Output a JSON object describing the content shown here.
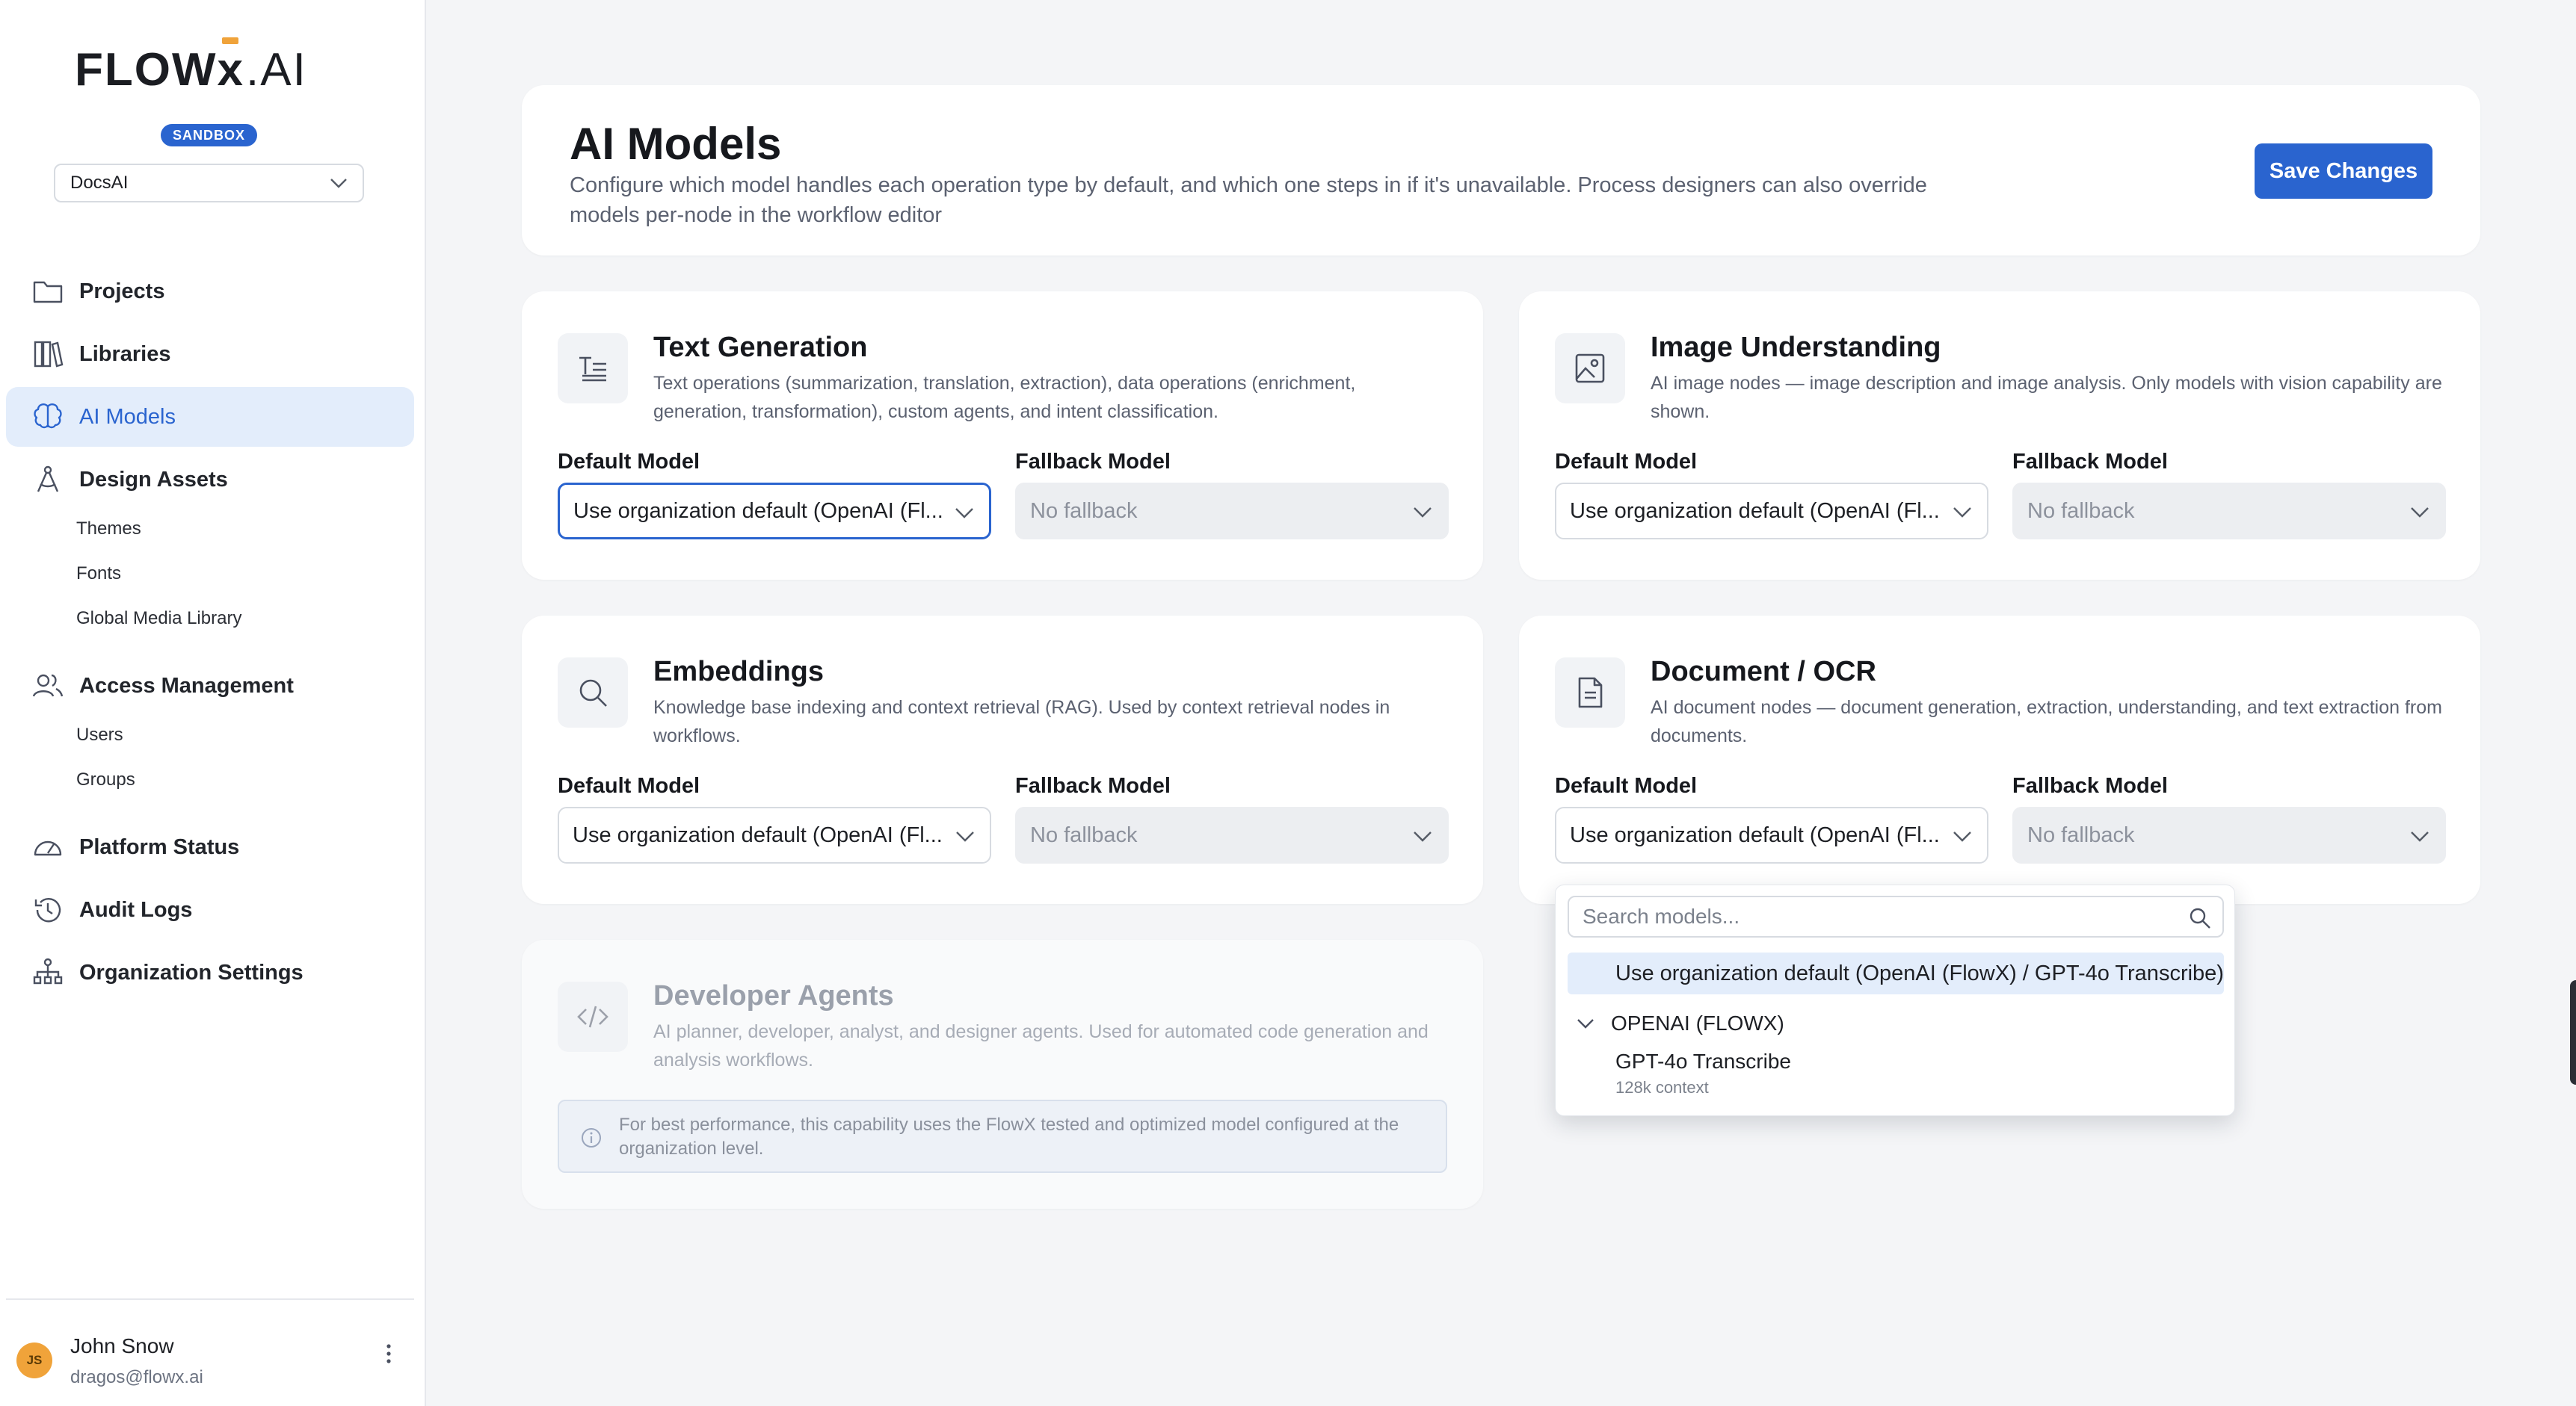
{
  "brand": {
    "logo_flow": "FLOW",
    "logo_x": "x",
    "logo_ai": ".AI",
    "environment_badge": "SANDBOX"
  },
  "workspace": {
    "selected": "DocsAI"
  },
  "sidebar": {
    "items": [
      {
        "label": "Projects",
        "icon": "folder-icon"
      },
      {
        "label": "Libraries",
        "icon": "books-icon"
      },
      {
        "label": "AI Models",
        "icon": "brain-icon",
        "active": true
      },
      {
        "label": "Design Assets",
        "icon": "compass-icon"
      },
      {
        "label": "Access Management",
        "icon": "users-icon"
      },
      {
        "label": "Platform Status",
        "icon": "gauge-icon"
      },
      {
        "label": "Audit Logs",
        "icon": "history-icon"
      },
      {
        "label": "Organization Settings",
        "icon": "org-tree-icon"
      }
    ],
    "design_assets_sub": [
      "Themes",
      "Fonts",
      "Global Media Library"
    ],
    "access_management_sub": [
      "Users",
      "Groups"
    ]
  },
  "user": {
    "initials": "JS",
    "name": "John Snow",
    "email": "dragos@flowx.ai"
  },
  "header": {
    "title": "AI Models",
    "description": "Configure which model handles each operation type by default, and which one steps in if it's unavailable. Process designers can also override models per-node in the workflow editor",
    "save_label": "Save Changes"
  },
  "labels": {
    "default_model": "Default Model",
    "fallback_model": "Fallback Model"
  },
  "capabilities": {
    "text_generation": {
      "title": "Text Generation",
      "description": "Text operations (summarization, translation, extraction), data operations (enrichment, generation, transformation), custom agents, and intent classification.",
      "default_value": "Use organization default (OpenAI (Fl...",
      "fallback_value": "No fallback"
    },
    "image_understanding": {
      "title": "Image Understanding",
      "description": "AI image nodes — image description and image analysis. Only models with vision capability are shown.",
      "default_value": "Use organization default (OpenAI (Fl...",
      "fallback_value": "No fallback"
    },
    "embeddings": {
      "title": "Embeddings",
      "description": "Knowledge base indexing and context retrieval (RAG). Used by context retrieval nodes in workflows.",
      "default_value": "Use organization default (OpenAI (Fl...",
      "fallback_value": "No fallback"
    },
    "document_ocr": {
      "title": "Document / OCR",
      "description": "AI document nodes — document generation, extraction, understanding, and text extraction from documents.",
      "default_value": "Use organization default (OpenAI (Fl...",
      "fallback_value": "No fallback"
    },
    "developer_agents": {
      "title": "Developer Agents",
      "description": "AI planner, developer, analyst, and designer agents. Used for automated code generation and analysis workflows.",
      "info": "For best performance, this capability uses the FlowX tested and optimized model configured at the organization level."
    }
  },
  "dropdown": {
    "search_placeholder": "Search models...",
    "selected_option": "Use organization default (OpenAI (FlowX) / GPT-4o Transcribe)",
    "group_label": "OPENAI (FLOWX)",
    "model_name": "GPT-4o Transcribe",
    "model_meta": "128k context"
  },
  "colors": {
    "accent": "#2a64cf",
    "active_bg": "#e3edfb",
    "brand_orange": "#f0a33a",
    "page_bg": "#f4f5f7"
  }
}
